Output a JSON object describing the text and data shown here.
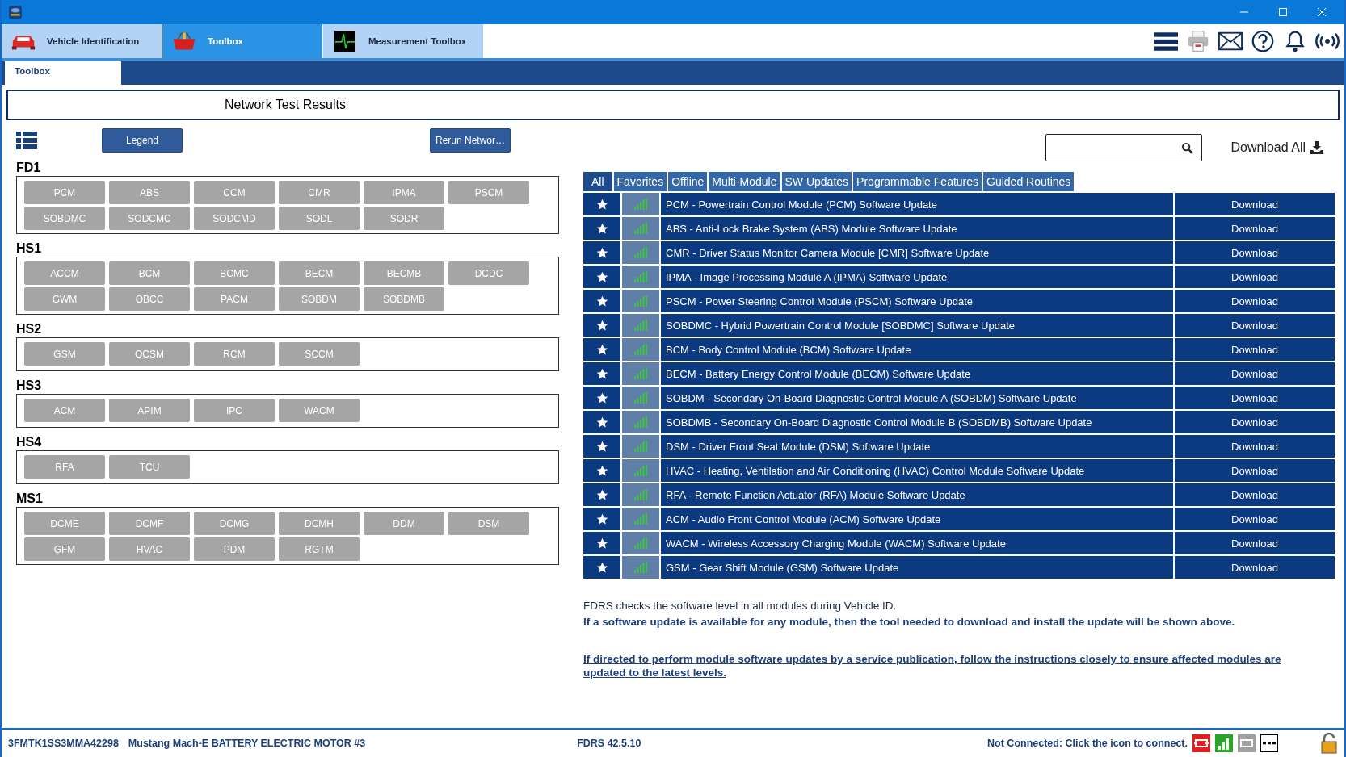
{
  "app_tabs": [
    {
      "label": "Vehicle Identification",
      "selected": false
    },
    {
      "label": "Toolbox",
      "selected": true
    },
    {
      "label": "Measurement Toolbox",
      "selected": false
    }
  ],
  "sub_tabs": [
    {
      "label": "Toolbox",
      "selected": true
    }
  ],
  "header": {
    "title": "Network Test Results"
  },
  "left": {
    "legend_button": "Legend",
    "rerun_button": "Rerun Networ…",
    "networks": [
      {
        "name": "FD1",
        "modules": [
          "PCM",
          "ABS",
          "CCM",
          "CMR",
          "IPMA",
          "PSCM",
          "SOBDMC",
          "SODCMC",
          "SODCMD",
          "SODL",
          "SODR"
        ]
      },
      {
        "name": "HS1",
        "modules": [
          "ACCM",
          "BCM",
          "BCMC",
          "BECM",
          "BECMB",
          "DCDC",
          "GWM",
          "OBCC",
          "PACM",
          "SOBDM",
          "SOBDMB"
        ]
      },
      {
        "name": "HS2",
        "modules": [
          "GSM",
          "OCSM",
          "RCM",
          "SCCM"
        ]
      },
      {
        "name": "HS3",
        "modules": [
          "ACM",
          "APIM",
          "IPC",
          "WACM"
        ]
      },
      {
        "name": "HS4",
        "modules": [
          "RFA",
          "TCU"
        ]
      },
      {
        "name": "MS1",
        "modules": [
          "DCME",
          "DCMF",
          "DCMG",
          "DCMH",
          "DDM",
          "DSM",
          "GFM",
          "HVAC",
          "PDM",
          "RGTM"
        ]
      }
    ]
  },
  "right": {
    "download_all": "Download All",
    "filters": [
      {
        "label": "All",
        "selected": true
      },
      {
        "label": "Favorites",
        "selected": false
      },
      {
        "label": "Offline",
        "selected": false
      },
      {
        "label": "Multi-Module",
        "selected": false
      },
      {
        "label": "SW Updates",
        "selected": false
      },
      {
        "label": "Programmable Features",
        "selected": false
      },
      {
        "label": "Guided Routines",
        "selected": false
      }
    ],
    "rows": [
      {
        "name": "PCM - Powertrain Control Module (PCM) Software Update",
        "action": "Download"
      },
      {
        "name": "ABS - Anti-Lock Brake System (ABS) Module Software Update",
        "action": "Download"
      },
      {
        "name": "CMR - Driver Status Monitor Camera Module [CMR] Software Update",
        "action": "Download"
      },
      {
        "name": "IPMA - Image Processing Module A (IPMA) Software Update",
        "action": "Download"
      },
      {
        "name": "PSCM - Power Steering Control Module (PSCM) Software Update",
        "action": "Download"
      },
      {
        "name": "SOBDMC - Hybrid Powertrain Control Module [SOBDMC] Software Update",
        "action": "Download"
      },
      {
        "name": "BCM - Body Control Module (BCM) Software Update",
        "action": "Download"
      },
      {
        "name": "BECM - Battery Energy Control Module (BECM) Software Update",
        "action": "Download"
      },
      {
        "name": "SOBDM - Secondary On-Board Diagnostic Control Module A (SOBDM) Software Update",
        "action": "Download"
      },
      {
        "name": "SOBDMB - Secondary On-Board Diagnostic Control Module B (SOBDMB) Software Update",
        "action": "Download"
      },
      {
        "name": "DSM - Driver Front Seat Module (DSM) Software Update",
        "action": "Download"
      },
      {
        "name": "HVAC - Heating, Ventilation and Air Conditioning (HVAC) Control Module Software Update",
        "action": "Download"
      },
      {
        "name": "RFA - Remote Function Actuator (RFA) Module Software Update",
        "action": "Download"
      },
      {
        "name": "ACM - Audio Front Control Module (ACM) Software Update",
        "action": "Download"
      },
      {
        "name": "WACM - Wireless Accessory Charging Module (WACM) Software Update",
        "action": "Download"
      },
      {
        "name": "GSM - Gear Shift Module (GSM) Software Update",
        "action": "Download"
      }
    ],
    "note": "FDRS checks the software level in all modules during Vehicle ID.",
    "note_bold": "If a software update is available for any module, then the tool needed to download and install the update will be shown above.",
    "link": "If directed to perform module software updates by a service publication, follow the instructions closely to ensure affected modules are updated to the latest levels."
  },
  "status_bar": {
    "vin": "3FMTK1SS3MMA42298",
    "vehicle": "Mustang Mach-E BATTERY ELECTRIC MOTOR #3",
    "version": "FDRS 42.5.10",
    "connection": "Not Connected: Click the icon to connect."
  }
}
